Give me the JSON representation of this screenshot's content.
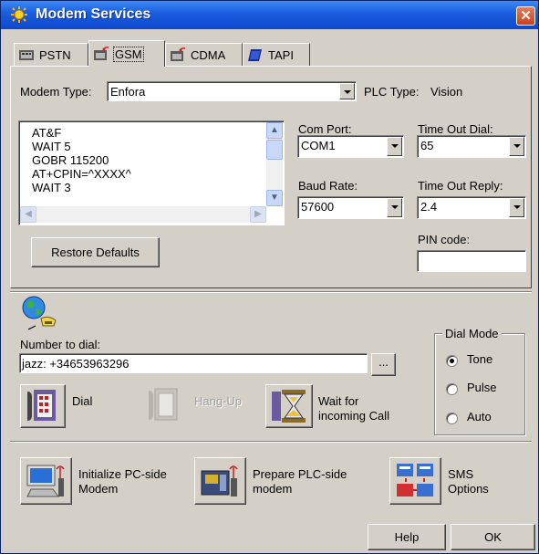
{
  "window": {
    "title": "Modem Services",
    "close_glyph": "✕"
  },
  "tabs": [
    {
      "label": "PSTN",
      "icon": "pstn-modem-icon",
      "active": false
    },
    {
      "label": "GSM",
      "icon": "gsm-modem-icon",
      "active": true
    },
    {
      "label": "CDMA",
      "icon": "cdma-modem-icon",
      "active": false
    },
    {
      "label": "TAPI",
      "icon": "tapi-book-icon",
      "active": false
    }
  ],
  "gsm": {
    "modem_type_label": "Modem Type:",
    "modem_type_value": "Enfora",
    "plc_type_label": "PLC Type:",
    "plc_type_value": "Vision",
    "init_script": [
      "AT&F",
      "WAIT 5",
      "GOBR 115200",
      "AT+CPIN=^XXXX^",
      "WAIT 3"
    ],
    "com_port_label": "Com Port:",
    "com_port_value": "COM1",
    "baud_rate_label": "Baud Rate:",
    "baud_rate_value": "57600",
    "timeout_dial_label": "Time Out Dial:",
    "timeout_dial_value": "65",
    "timeout_reply_label": "Time Out Reply:",
    "timeout_reply_value": "2.4",
    "pin_code_label": "PIN code:",
    "pin_code_value": "",
    "restore_defaults_label": "Restore Defaults"
  },
  "dial": {
    "number_label": "Number to dial:",
    "number_value": "jazz: +34653963296",
    "browse_label": "...",
    "dial_label": "Dial",
    "hangup_label": "Hang-Up",
    "wait_label_1": "Wait for",
    "wait_label_2": "incoming Call"
  },
  "dial_mode": {
    "title": "Dial Mode",
    "options": [
      {
        "label": "Tone",
        "selected": true
      },
      {
        "label": "Pulse",
        "selected": false
      },
      {
        "label": "Auto",
        "selected": false
      }
    ]
  },
  "actions": {
    "init_pc_1": "Initialize PC-side",
    "init_pc_2": "Modem",
    "prepare_plc_1": "Prepare PLC-side",
    "prepare_plc_2": "modem",
    "sms_1": "SMS",
    "sms_2": "Options"
  },
  "footer": {
    "help_label": "Help",
    "ok_label": "OK"
  },
  "colors": {
    "titlebar": "#0b48cf",
    "dialog_face": "#d4d0c8",
    "close": "#c9401d"
  }
}
